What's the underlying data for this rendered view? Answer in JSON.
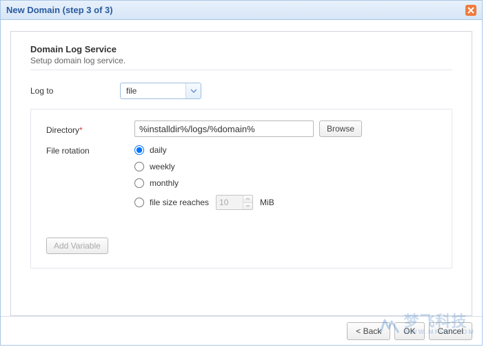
{
  "dialog": {
    "title": "New Domain (step 3 of 3)"
  },
  "section": {
    "title": "Domain Log Service",
    "subtitle": "Setup domain log service."
  },
  "log_to": {
    "label": "Log to",
    "value": "file"
  },
  "directory": {
    "label": "Directory",
    "value": "%installdir%/logs/%domain%",
    "browse": "Browse"
  },
  "rotation": {
    "label": "File rotation",
    "options": {
      "daily": "daily",
      "weekly": "weekly",
      "monthly": "monthly",
      "filesize": "file size reaches",
      "filesize_value": "10",
      "filesize_unit": "MiB"
    },
    "selected": "daily"
  },
  "add_variable": "Add Variable",
  "footer": {
    "back": "< Back",
    "ok": "OK",
    "cancel": "Cancel"
  },
  "watermark": {
    "main": "梦飞科技",
    "sub": "WWW.MFISP.COM"
  }
}
